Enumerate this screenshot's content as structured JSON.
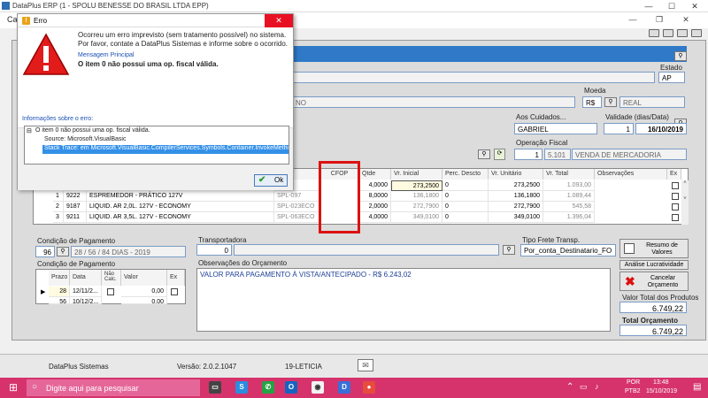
{
  "window": {
    "title": "DataPlus ERP (1 - SPOLU BENESSE DO BRASIL LTDA EPP)",
    "minimize": "—",
    "maximize": "☐",
    "close": "✕",
    "menu_partial": "Ca"
  },
  "error_dialog": {
    "title": "Erro",
    "message_line1": "Ocorreu um erro imprevisto (sem tratamento possível) no sistema.",
    "message_line2": "Por favor, contate a DataPlus Sistemas e informe sobre o ocorrido.",
    "main_message_label": "Mensagem Principal",
    "main_message": "O item 0 não possui uma op. fiscal válida.",
    "info_label": "Informações sobre o erro:",
    "tree": {
      "root": "O item 0 não possui uma op. fiscal válida.",
      "source": "Source: Microsoft.VisualBasic",
      "stack_trace": "Stack Trace:   em Microsoft.VisualBasic.CompilerServices.Symbols.Container.InvokeMethod(Method"
    },
    "ok_label": "Ok"
  },
  "form": {
    "estado_label": "Estado",
    "estado_value": "AP",
    "moeda_label": "Moeda",
    "moeda_code": "R$",
    "moeda_name": "REAL",
    "partial_text": "NO",
    "aos_cuidados_label": "Aos Cuidados...",
    "aos_cuidados_value": "GABRIEL",
    "validade_label": "Validade (dias/Data)",
    "validade_days": "1",
    "validade_date": "16/10/2019",
    "operacao_fiscal_label": "Operação Fiscal",
    "operacao_fiscal_num": "1",
    "operacao_fiscal_code": "5.101",
    "operacao_fiscal_desc": "VENDA DE MERCADORIA"
  },
  "items_grid": {
    "headers": [
      "Ref.",
      "CFOP",
      "Qtde",
      "Vr. Inicial",
      "Perc. Descto",
      "Vr. Unitário",
      "Vr. Total",
      "Observações",
      "Ex"
    ],
    "rows": [
      {
        "n": "",
        "code": "",
        "desc": "",
        "ref": "...6",
        "qtde": "4,0000",
        "vr_inicial": "273,2500",
        "perc": "0",
        "vr_unit": "273,2500",
        "vr_total": "1.093,00"
      },
      {
        "n": "1",
        "code": "9222",
        "desc": "ESPREMEDOR - PRÁTICO 127V",
        "ref": "SPL-097",
        "qtde": "8,0000",
        "vr_inicial": "136,1800",
        "perc": "0",
        "vr_unit": "136,1800",
        "vr_total": "1.089,44"
      },
      {
        "n": "2",
        "code": "9187",
        "desc": "LIQUID. AR  2,0L. 127V - ECONOMY",
        "ref": "SPL-023ECO",
        "qtde": "2,0000",
        "vr_inicial": "272,7900",
        "perc": "0",
        "vr_unit": "272,7900",
        "vr_total": "545,58"
      },
      {
        "n": "3",
        "code": "9211",
        "desc": "LIQUID. AR  3,5L. 127V - ECONOMY",
        "ref": "SPL-063ECO",
        "qtde": "4,0000",
        "vr_inicial": "349,0100",
        "perc": "0",
        "vr_unit": "349,0100",
        "vr_total": "1.396,04"
      }
    ]
  },
  "payment": {
    "condicao_label": "Condição de Pagamento",
    "condicao_code": "96",
    "condicao_value": "28 / 56 / 84 DIAS - 2019",
    "transportadora_label": "Transportadora",
    "transportadora_value": "0",
    "tipo_frete_label": "Tipo Frete Transp.",
    "tipo_frete_value": "Por_conta_Destinatario_FO",
    "condicao2_label": "Condição de Pagamento",
    "grid_headers": [
      "Prazo",
      "Data",
      "Não Calc.",
      "Valor",
      "Ex"
    ],
    "grid_rows": [
      {
        "prazo": "28",
        "data": "12/11/2...",
        "valor": "0,00"
      },
      {
        "prazo": "56",
        "data": "10/12/2...",
        "valor": "0,00"
      }
    ],
    "obs_label": "Observações do Orçamento",
    "obs_value": "VALOR PARA PAGAMENTO À VISTA/ANTECIPADO - R$ 6.243,02"
  },
  "side_buttons": {
    "resumo": "Resumo de Valores",
    "analise": "Análise Lucratividade",
    "cancelar": "Cancelar Orçamento",
    "valor_total_label": "Valor Total dos Produtos",
    "valor_total": "6.749,22",
    "total_orc_label": "Total Orçamento",
    "total_orc": "6.749,22"
  },
  "statusbar": {
    "company": "DataPlus Sistemas",
    "version": "Versão: 2.0.2.1047",
    "user": "19-LETICIA"
  },
  "taskbar": {
    "search_placeholder": "Digite aqui para pesquisar",
    "lang1": "POR",
    "lang2": "PTB2",
    "time": "13:48",
    "date": "15/10/2019"
  }
}
